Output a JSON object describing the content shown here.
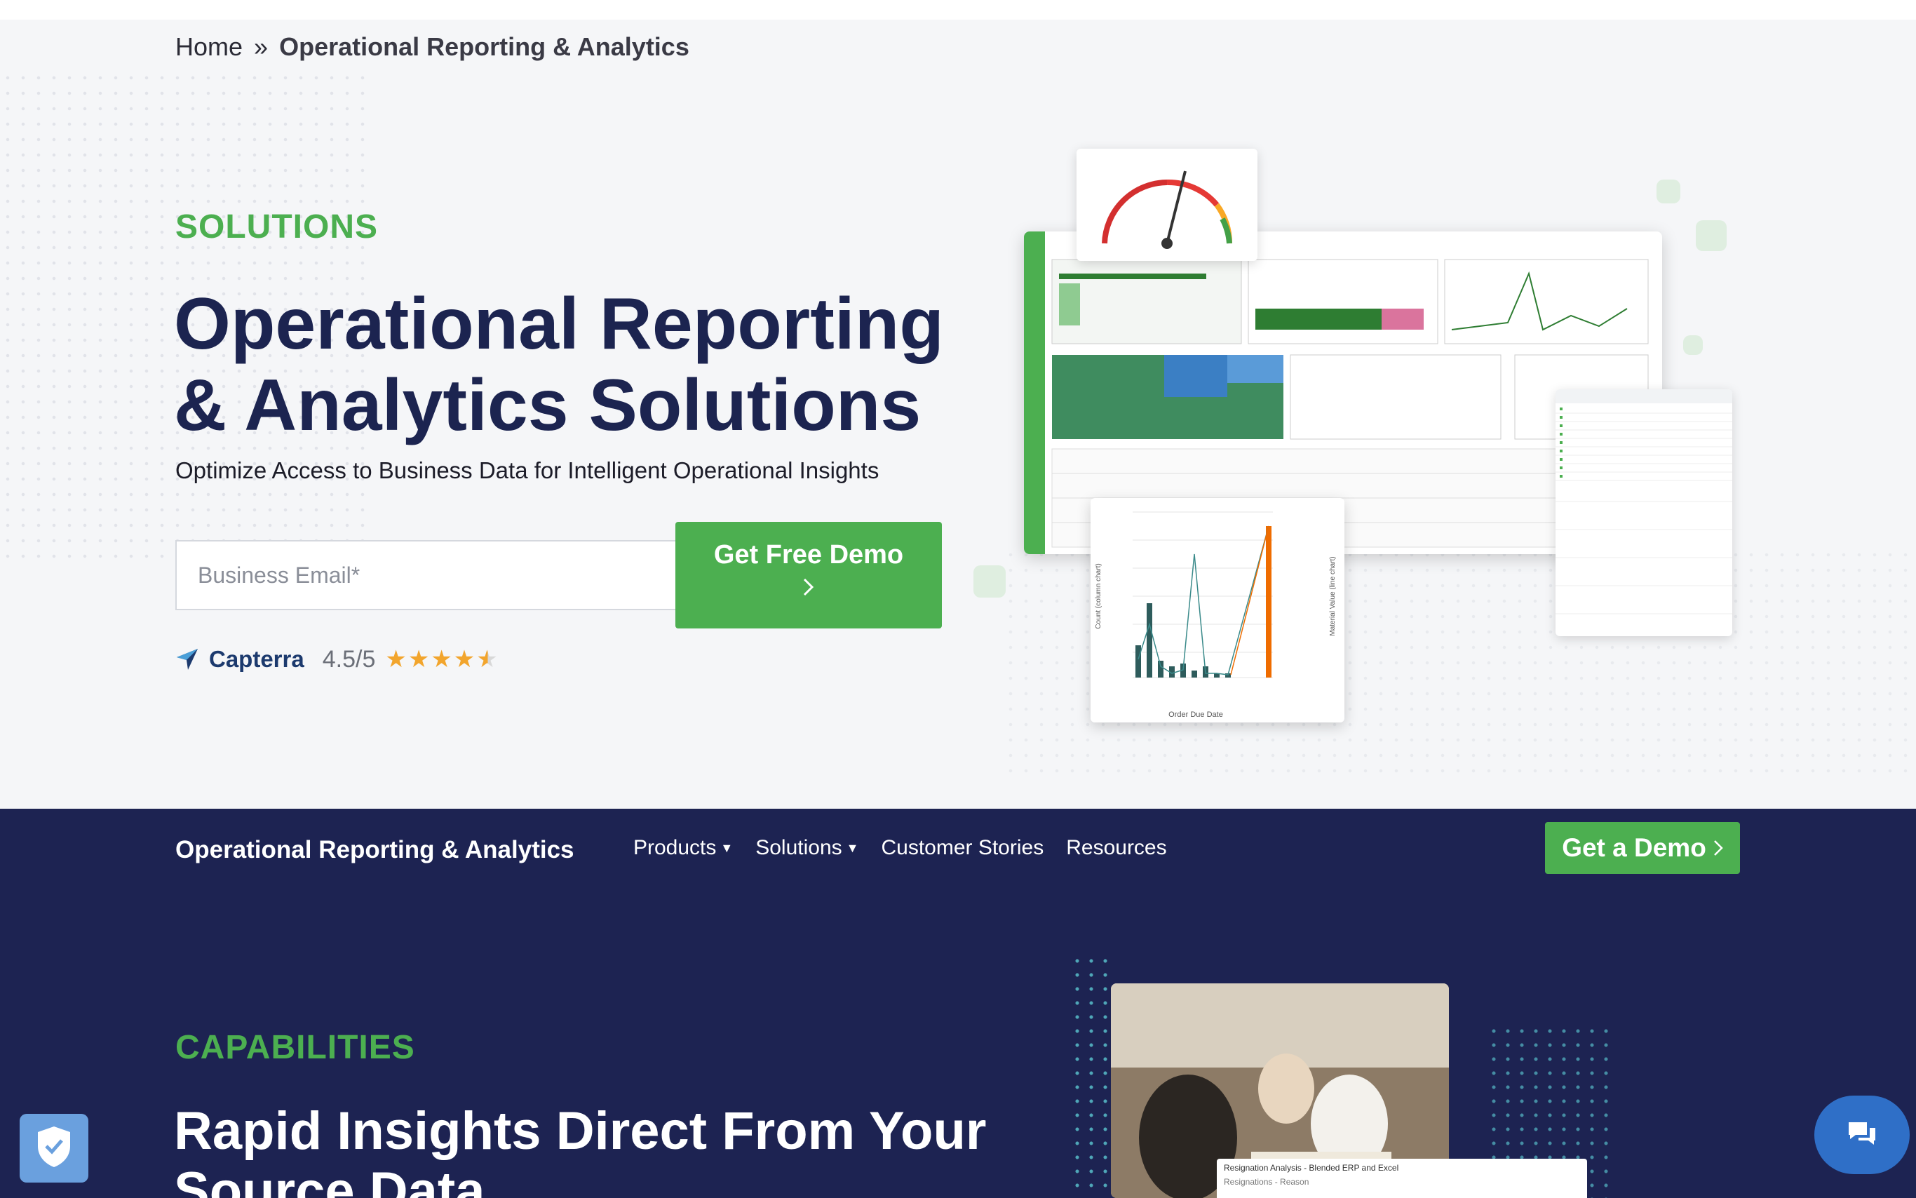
{
  "breadcrumb": {
    "home": "Home",
    "separator": "»",
    "current": "Operational Reporting & Analytics"
  },
  "hero": {
    "eyebrow": "SOLUTIONS",
    "title_line1": "Operational Reporting",
    "title_line2": "& Analytics Solutions",
    "subtitle": "Optimize Access to Business Data for Intelligent Operational Insights",
    "email_placeholder": "Business Email*",
    "cta_label": "Get Free Demo",
    "cta_icon": "chevron-right-icon"
  },
  "capterra": {
    "name": "Capterra",
    "rating": "4.5/5",
    "stars": "★★★★",
    "half_star": "★",
    "rating_value": 4.5,
    "star_color": "#f2a52d"
  },
  "mockup": {
    "chart_xlabel": "Order Due Date",
    "chart_ylabel_left": "Count (column chart)",
    "chart_ylabel_right": "Material Value (line chart)",
    "overlay_title": "Resignation Analysis - Blended ERP and Excel",
    "overlay_row": "Resignations - Reason"
  },
  "nav": {
    "brand": "Operational Reporting & Analytics",
    "links": [
      {
        "label": "Products",
        "has_caret": true
      },
      {
        "label": "Solutions",
        "has_caret": true
      },
      {
        "label": "Customer Stories",
        "has_caret": false
      },
      {
        "label": "Resources",
        "has_caret": false
      }
    ],
    "cta": "Get a Demo"
  },
  "capabilities": {
    "eyebrow": "CAPABILITIES",
    "title": "Rapid Insights Direct From Your Source Data"
  },
  "colors": {
    "navy": "#1c2450",
    "green": "#4caf50",
    "band": "#1d2352",
    "chat": "#2f6fc7",
    "shield": "#6aa0de"
  }
}
